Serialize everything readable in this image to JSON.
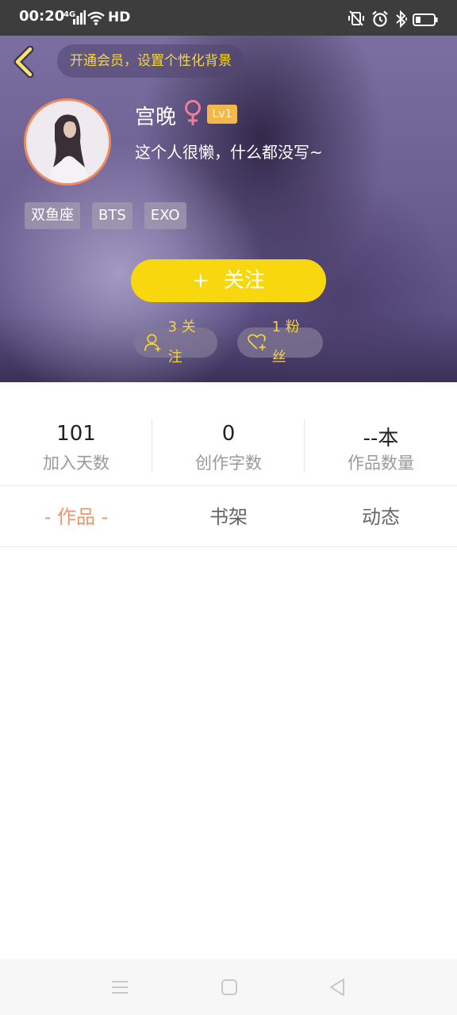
{
  "status_bar": {
    "time": "00:20",
    "network": "4G",
    "hd": "HD"
  },
  "header": {
    "vip_prompt": "开通会员，设置个性化背景",
    "username": "宫晚",
    "gender_symbol": "♀",
    "level": "Lv1",
    "bio": "这个人很懒，什么都没写~",
    "tags": [
      "双鱼座",
      "BTS",
      "EXO"
    ],
    "follow_plus": "+",
    "follow_label": "关注",
    "following": "3 关注",
    "fans": "1 粉丝"
  },
  "stats": [
    {
      "value": "101",
      "label": "加入天数"
    },
    {
      "value": "0",
      "label": "创作字数"
    },
    {
      "value": "--本",
      "label": "作品数量"
    }
  ],
  "tabs": [
    {
      "label": "- 作品 -",
      "active": true
    },
    {
      "label": "书架",
      "active": false
    },
    {
      "label": "动态",
      "active": false
    }
  ],
  "colors": {
    "accent_yellow": "#f8d70f",
    "tab_active": "#f0956a",
    "avatar_ring": "#f08a5d",
    "level_badge": "#f2b84b",
    "female_icon": "#f07d97"
  },
  "icons": {
    "back": "chevron-left-icon",
    "following": "user-plus-icon",
    "fans": "heart-plus-icon"
  }
}
